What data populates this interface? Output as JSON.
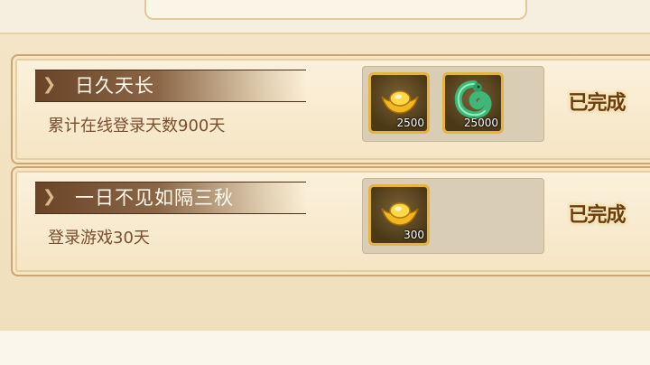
{
  "tasks": [
    {
      "title": "日久天长",
      "description": "累计在线登录天数900天",
      "rewards": [
        {
          "icon": "gold-ingot-icon",
          "count": "2500"
        },
        {
          "icon": "jade-dragon-icon",
          "count": "25000"
        }
      ],
      "status": "已完成"
    },
    {
      "title": "一日不见如隔三秋",
      "description": "登录游戏30天",
      "rewards": [
        {
          "icon": "gold-ingot-icon",
          "count": "300"
        }
      ],
      "status": "已完成"
    }
  ]
}
